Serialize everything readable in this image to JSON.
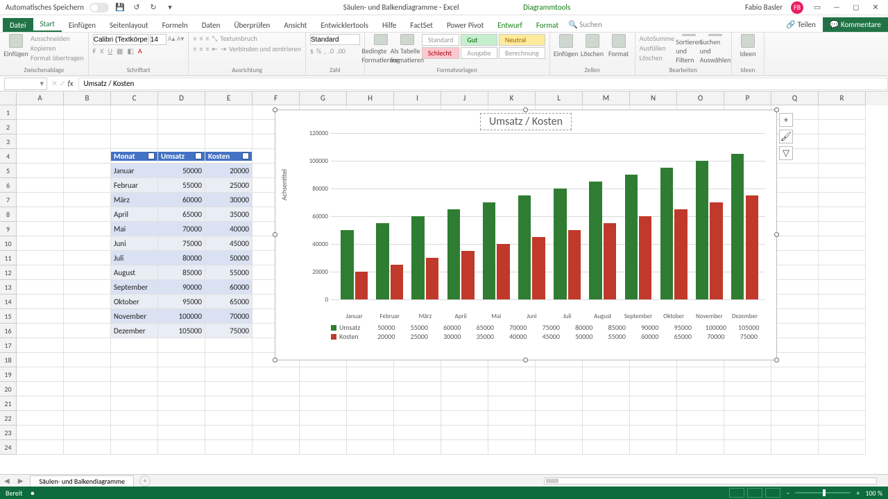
{
  "window": {
    "autosave_label": "Automatisches Speichern",
    "title_doc": "Säulen- und Balkendiagramme - Excel",
    "context_tools": "Diagrammtools",
    "user_name": "Fabio Basler",
    "user_initials": "FB"
  },
  "tabs": {
    "file": "Datei",
    "home": "Start",
    "insert": "Einfügen",
    "pagelayout": "Seitenlayout",
    "formulas": "Formeln",
    "data": "Daten",
    "review": "Überprüfen",
    "view": "Ansicht",
    "dev": "Entwicklertools",
    "help": "Hilfe",
    "factset": "FactSet",
    "powerpivot": "Power Pivot",
    "design": "Entwurf",
    "format": "Format",
    "search_ph": "Suchen",
    "share": "Teilen",
    "comments": "Kommentare"
  },
  "ribbon": {
    "clipboard": {
      "paste": "Einfügen",
      "cut": "Ausschneiden",
      "copy": "Kopieren",
      "fmtpaint": "Format übertragen",
      "label": "Zwischenablage"
    },
    "font": {
      "family": "Calibri (Textkörper)",
      "size": "14",
      "label": "Schriftart"
    },
    "align": {
      "wrap": "Textumbruch",
      "merge": "Verbinden und zentrieren",
      "label": "Ausrichtung"
    },
    "number": {
      "fmt": "Standard",
      "label": "Zahl"
    },
    "cond": {
      "cond": "Bedingte Formatierung",
      "astable": "Als Tabelle formatieren"
    },
    "styles": {
      "standard": "Standard",
      "gut": "Gut",
      "neutral": "Neutral",
      "schlecht": "Schlecht",
      "ausgabe": "Ausgabe",
      "berechnung": "Berechnung",
      "label": "Formatvorlagen"
    },
    "cells": {
      "insert": "Einfügen",
      "delete": "Löschen",
      "format": "Format",
      "label": "Zellen"
    },
    "editing": {
      "sum": "AutoSumme",
      "fill": "Ausfüllen",
      "clear": "Löschen",
      "sort": "Sortieren und Filtern",
      "find": "Suchen und Auswählen",
      "label": "Bearbeiten"
    },
    "ideas": {
      "btn": "Ideen",
      "label": "Ideen"
    }
  },
  "fxbar": {
    "name": "",
    "formula": "Umsatz / Kosten"
  },
  "columns": [
    "A",
    "B",
    "C",
    "D",
    "E",
    "F",
    "G",
    "H",
    "I",
    "J",
    "K",
    "L",
    "M",
    "N",
    "O",
    "P",
    "Q",
    "R"
  ],
  "table": {
    "headers": {
      "month": "Monat",
      "rev": "Umsatz",
      "cost": "Kosten"
    },
    "rows": [
      {
        "m": "Januar",
        "u": "50000",
        "k": "20000"
      },
      {
        "m": "Februar",
        "u": "55000",
        "k": "25000"
      },
      {
        "m": "März",
        "u": "60000",
        "k": "30000"
      },
      {
        "m": "April",
        "u": "65000",
        "k": "35000"
      },
      {
        "m": "Mai",
        "u": "70000",
        "k": "40000"
      },
      {
        "m": "Juni",
        "u": "75000",
        "k": "45000"
      },
      {
        "m": "Juli",
        "u": "80000",
        "k": "50000"
      },
      {
        "m": "August",
        "u": "85000",
        "k": "55000"
      },
      {
        "m": "September",
        "u": "90000",
        "k": "60000"
      },
      {
        "m": "Oktober",
        "u": "95000",
        "k": "65000"
      },
      {
        "m": "November",
        "u": "100000",
        "k": "70000"
      },
      {
        "m": "Dezember",
        "u": "105000",
        "k": "75000"
      }
    ]
  },
  "chart_data": {
    "type": "bar",
    "title": "Umsatz / Kosten",
    "ylabel": "Achsentitel",
    "ylim": [
      0,
      120000
    ],
    "yticks": [
      0,
      20000,
      40000,
      60000,
      80000,
      100000,
      120000
    ],
    "categories": [
      "Januar",
      "Februar",
      "März",
      "April",
      "Mai",
      "Juni",
      "Juli",
      "August",
      "September",
      "Oktober",
      "November",
      "Dezember"
    ],
    "series": [
      {
        "name": "Umsatz",
        "color": "#2e7d32",
        "values": [
          50000,
          55000,
          60000,
          65000,
          70000,
          75000,
          80000,
          85000,
          90000,
          95000,
          100000,
          105000
        ]
      },
      {
        "name": "Kosten",
        "color": "#c0392b",
        "values": [
          20000,
          25000,
          30000,
          35000,
          40000,
          45000,
          50000,
          55000,
          60000,
          65000,
          70000,
          75000
        ]
      }
    ]
  },
  "sheet": {
    "name": "Säulen- und Balkendiagramme"
  },
  "status": {
    "ready": "Bereit",
    "zoom": "100 %"
  }
}
